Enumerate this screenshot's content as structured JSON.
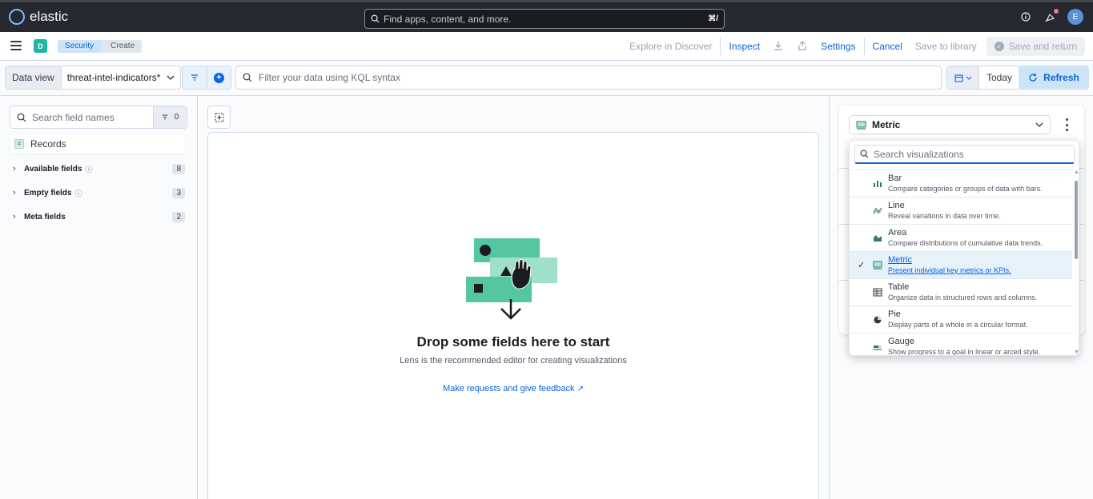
{
  "header": {
    "logo_text": "elastic",
    "search_placeholder": "Find apps, content, and more.",
    "search_shortcut": "⌘/",
    "avatar_initial": "E"
  },
  "navbar": {
    "space_initial": "D",
    "breadcrumbs": [
      "Security",
      "Create"
    ],
    "explore_label": "Explore in Discover",
    "inspect_label": "Inspect",
    "settings_label": "Settings",
    "cancel_label": "Cancel",
    "save_library_label": "Save to library",
    "save_return_label": "Save and return"
  },
  "querybar": {
    "dataview_label": "Data view",
    "dataview_value": "threat-intel-indicators*",
    "kql_placeholder": "Filter your data using KQL syntax",
    "date_label": "Today",
    "refresh_label": "Refresh"
  },
  "fields": {
    "search_placeholder": "Search field names",
    "filter_count": "0",
    "records_label": "Records",
    "groups": [
      {
        "label": "Available fields",
        "count": "8",
        "info": true
      },
      {
        "label": "Empty fields",
        "count": "3",
        "info": true
      },
      {
        "label": "Meta fields",
        "count": "2",
        "info": false
      }
    ]
  },
  "workspace": {
    "drop_title": "Drop some fields here to start",
    "drop_subtitle": "Lens is the recommended editor for creating visualizations",
    "feedback_link": "Make requests and give feedback"
  },
  "config": {
    "selected_vis": "Metric",
    "search_placeholder": "Search visualizations",
    "items": [
      {
        "title": "Bar",
        "desc": "Compare categories or groups of data with bars.",
        "icon": "bar-chart-icon",
        "selected": false
      },
      {
        "title": "Line",
        "desc": "Reveal variations in data over time.",
        "icon": "line-chart-icon",
        "selected": false
      },
      {
        "title": "Area",
        "desc": "Compare distributions of cumulative data trends.",
        "icon": "area-chart-icon",
        "selected": false
      },
      {
        "title": "Metric",
        "desc": "Present individual key metrics or KPIs.",
        "icon": "metric-icon",
        "selected": true
      },
      {
        "title": "Table",
        "desc": "Organize data in structured rows and columns.",
        "icon": "table-icon",
        "selected": false
      },
      {
        "title": "Pie",
        "desc": "Display parts of a whole in a circular format.",
        "icon": "pie-chart-icon",
        "selected": false
      },
      {
        "title": "Gauge",
        "desc": "Show progress to a goal in linear or arced style.",
        "icon": "gauge-icon",
        "selected": false
      }
    ]
  },
  "colors": {
    "accent": "#0b64dd",
    "header_bg": "#25282f",
    "space_badge": "#1cb5a8",
    "illustration_green": "#54c7a0"
  }
}
